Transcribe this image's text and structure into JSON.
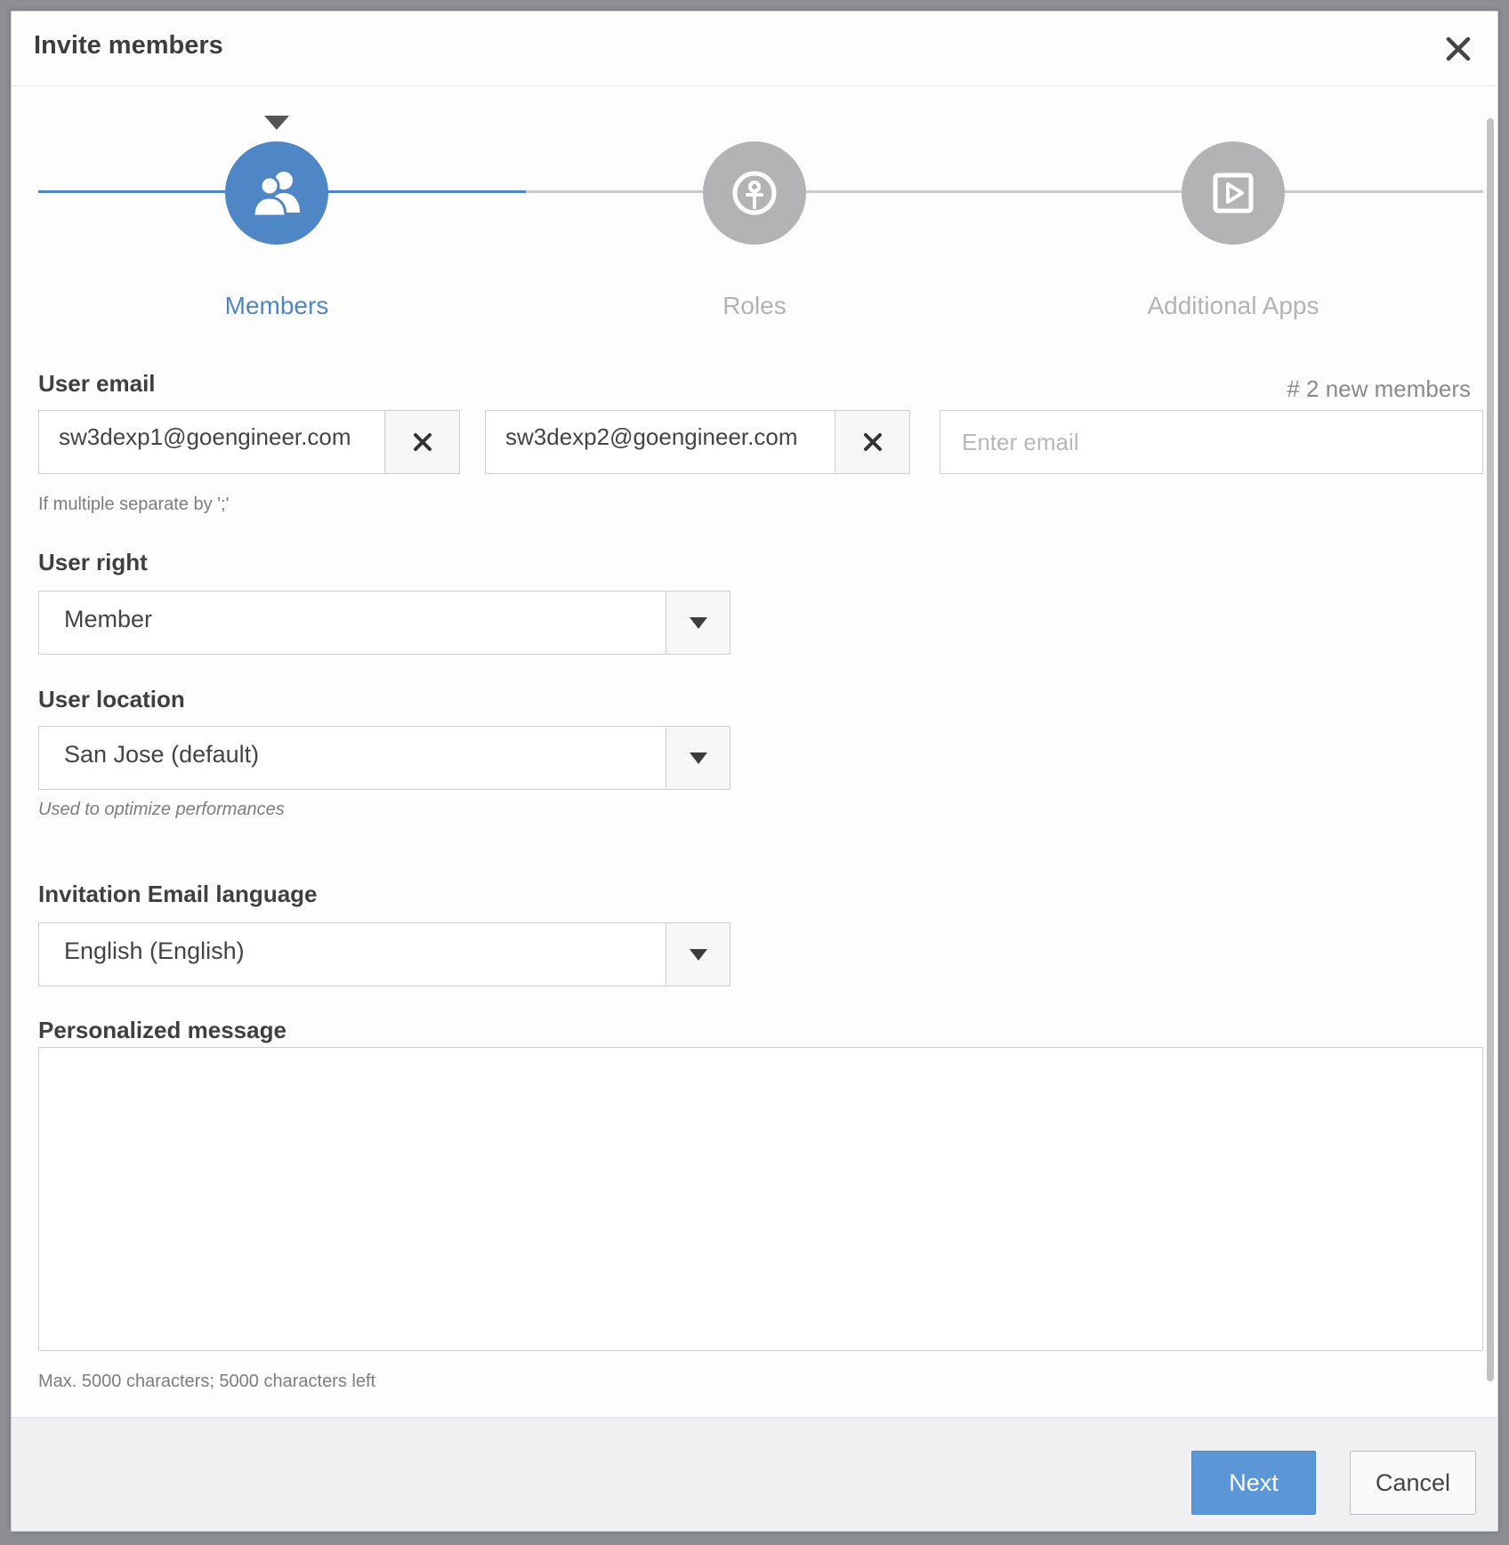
{
  "dialog": {
    "title": "Invite members"
  },
  "steps": [
    {
      "label": "Members",
      "icon": "users-icon",
      "active": true
    },
    {
      "label": "Roles",
      "icon": "role-icon",
      "active": false
    },
    {
      "label": "Additional Apps",
      "icon": "apps-icon",
      "active": false
    }
  ],
  "user_email": {
    "label": "User email",
    "member_count": "# 2 new members",
    "emails": [
      "sw3dexp1@goengineer.com",
      "sw3dexp2@goengineer.com"
    ],
    "placeholder": "Enter email",
    "hint": "If multiple separate by ';'"
  },
  "user_right": {
    "label": "User right",
    "value": "Member"
  },
  "user_location": {
    "label": "User location",
    "value": "San Jose (default)",
    "hint": "Used to optimize performances"
  },
  "email_language": {
    "label": "Invitation Email language",
    "value": "English (English)"
  },
  "message": {
    "label": "Personalized message",
    "hint": "Max. 5000 characters; 5000 characters left"
  },
  "footer": {
    "next_label": "Next",
    "cancel_label": "Cancel"
  },
  "colors": {
    "accent": "#4f86c6",
    "inactive": "#b3b3b5",
    "primary_button": "#5b96d6"
  }
}
